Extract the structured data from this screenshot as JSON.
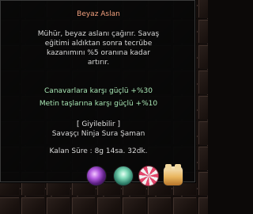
{
  "tooltip": {
    "title": "Beyaz Aslan",
    "description_lines": [
      "Mühür, beyaz aslanı çağırır. Savaş",
      "eğitimi aldıktan sonra tecrübe",
      "kazanımını %5 oranına kadar",
      "artırır."
    ],
    "bonuses": [
      "Canavarlara karşı güçlü +%30",
      "Metin taşlarına karşı güçlü +%10"
    ],
    "condition": "[ Giyilebilir ]",
    "classes": "Savaşçı Ninja Sura Şaman",
    "remaining": "Kalan Süre : 8g 14sa. 32dk."
  },
  "tray_icons": [
    "purple-orb-icon",
    "green-lens-icon",
    "lollipop-icon",
    "lion-cub-icon"
  ],
  "colors": {
    "title": "#f2a07e",
    "bonus": "#a8e6b4",
    "text": "#d8d8d8",
    "tooltip_bg": "#080808"
  }
}
